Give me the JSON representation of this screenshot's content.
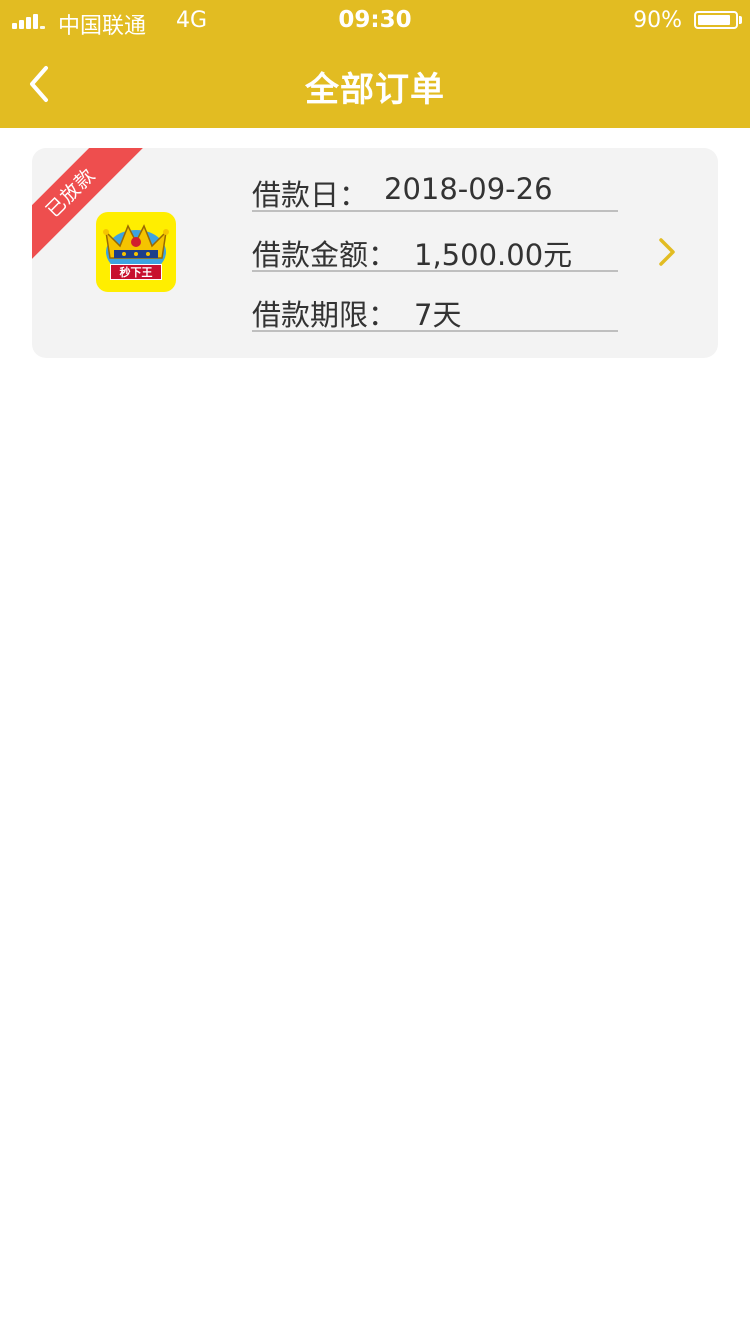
{
  "status_bar": {
    "carrier": "中国联通",
    "network": "4G",
    "time": "09:30",
    "battery": "90%",
    "battery_level": 0.9
  },
  "nav": {
    "title": "全部订单"
  },
  "colors": {
    "accent": "#E2BC22",
    "ribbon": "#EE4E4E",
    "card_bg": "#F3F3F3"
  },
  "order": {
    "status_badge": "已放款",
    "app_logo_text": "秒下王",
    "loan_date_label": "借款日：",
    "loan_date": "2018-09-26",
    "amount_label": "借款金额：",
    "amount": "1,500.00元",
    "term_label": "借款期限：",
    "term": "7天"
  },
  "icons": {
    "back": "chevron-left-icon",
    "detail": "chevron-right-icon",
    "signal": "signal-icon",
    "battery": "battery-icon",
    "logo": "crown-logo-icon"
  }
}
